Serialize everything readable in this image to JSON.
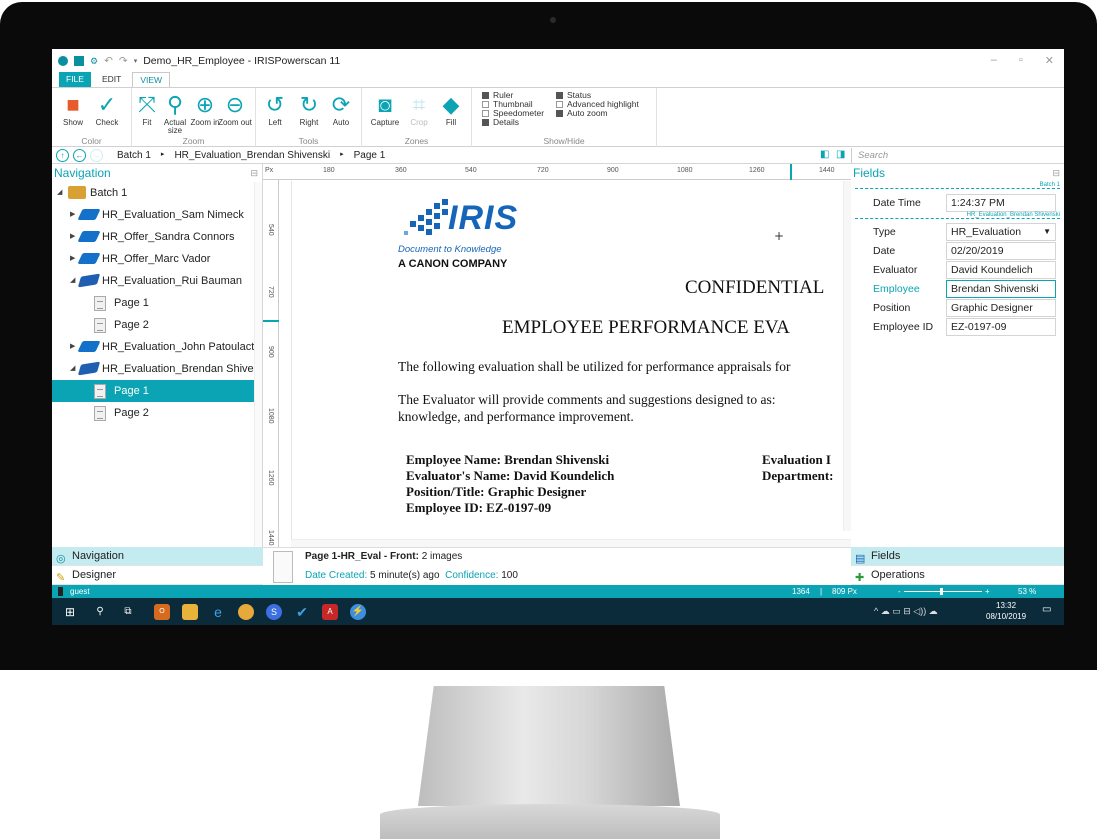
{
  "window": {
    "app_title": "Demo_HR_Employee - IRISPowerscan 11"
  },
  "menu_tabs": [
    "FILE",
    "EDIT",
    "VIEW"
  ],
  "ribbon": {
    "color": {
      "label": "Color",
      "buttons": [
        "Show",
        "Check"
      ]
    },
    "zoom": {
      "label": "Zoom",
      "buttons": [
        "Fit",
        "Actual size",
        "Zoom in",
        "Zoom out"
      ]
    },
    "tools": {
      "label": "Tools",
      "buttons": [
        "Left",
        "Right",
        "Auto"
      ]
    },
    "zones": {
      "label": "Zones",
      "buttons": [
        "Capture",
        "Crop",
        "Fill"
      ]
    },
    "showhide": {
      "label": "Show/Hide",
      "options": [
        {
          "label": "Ruler",
          "checked": true
        },
        {
          "label": "Thumbnail",
          "checked": false
        },
        {
          "label": "Speedometer",
          "checked": false
        },
        {
          "label": "Details",
          "checked": true
        },
        {
          "label": "Status",
          "checked": true
        },
        {
          "label": "Advanced highlight",
          "checked": false
        },
        {
          "label": "Auto zoom",
          "checked": true
        }
      ]
    }
  },
  "breadcrumb": [
    "Batch 1",
    "HR_Evaluation_Brendan Shivenski",
    "Page 1"
  ],
  "search": {
    "placeholder": "Search"
  },
  "navigation": {
    "title": "Navigation",
    "items": [
      {
        "label": "Batch 1",
        "type": "batch"
      },
      {
        "label": "HR_Evaluation_Sam Nimeck",
        "type": "doc"
      },
      {
        "label": "HR_Offer_Sandra Connors",
        "type": "doc"
      },
      {
        "label": "HR_Offer_Marc Vador",
        "type": "doc"
      },
      {
        "label": "HR_Evaluation_Rui Bauman",
        "type": "doc-open"
      },
      {
        "label": "Page 1",
        "type": "page"
      },
      {
        "label": "Page 2",
        "type": "page"
      },
      {
        "label": "HR_Evaluation_John Patoulact",
        "type": "doc"
      },
      {
        "label": "HR_Evaluation_Brendan Shive",
        "type": "doc-open"
      },
      {
        "label": "Page 1",
        "type": "page",
        "selected": true
      },
      {
        "label": "Page 2",
        "type": "page"
      }
    ]
  },
  "ruler": {
    "unit": "Px",
    "h_ticks": [
      "180",
      "360",
      "540",
      "720",
      "900",
      "1080",
      "1260",
      "1440"
    ],
    "v_ticks": [
      "540",
      "720",
      "900",
      "1080",
      "1260",
      "1440"
    ]
  },
  "document": {
    "logo": "IRIS",
    "logo_sub": "Document to Knowledge",
    "logo_canon": "A CANON COMPANY",
    "confidential": "CONFIDENTIAL",
    "heading": "EMPLOYEE PERFORMANCE EVA",
    "para1": "The following evaluation shall be utilized for performance appraisals for",
    "para2a": "The Evaluator will provide comments and suggestions designed to as:",
    "para2b": "knowledge, and performance improvement.",
    "emp_name": "Employee Name: Brendan Shivenski",
    "eval_name": "Evaluator's Name: David Koundelich",
    "position": "Position/Title: Graphic Designer",
    "emp_id": "Employee ID: EZ-0197-09",
    "eval_d": "Evaluation I",
    "dept": "Department:"
  },
  "fields": {
    "title": "Fields",
    "batch_sep": "Batch 1",
    "date_time_label": "Date Time",
    "date_time_value": "1:24:37 PM",
    "doc_sep": "HR_Evaluation_Brendan Shivenski",
    "rows": [
      {
        "label": "Type",
        "value": "HR_Evaluation"
      },
      {
        "label": "Date",
        "value": "02/20/2019"
      },
      {
        "label": "Evaluator",
        "value": "David Koundelich"
      },
      {
        "label": "Employee",
        "value": "Brendan Shivenski"
      },
      {
        "label": "Position",
        "value": "Graphic Designer"
      },
      {
        "label": "Employee ID",
        "value": "EZ-0197-09"
      }
    ]
  },
  "bottom_left": [
    "Navigation",
    "Designer"
  ],
  "bottom_right": [
    "Fields",
    "Operations"
  ],
  "info": {
    "title_bold": "Page 1-HR_Eval - Front:",
    "title_rest": "2 images",
    "created_label": "Date Created:",
    "created_value": "5 minute(s) ago",
    "confidence_label": "Confidence:",
    "confidence_value": "100"
  },
  "status": {
    "user": "guest",
    "coord_x": "1364",
    "coord_y": "809 Px",
    "zoom": "53 %"
  },
  "taskbar": {
    "time": "13:32",
    "date": "08/10/2019"
  }
}
